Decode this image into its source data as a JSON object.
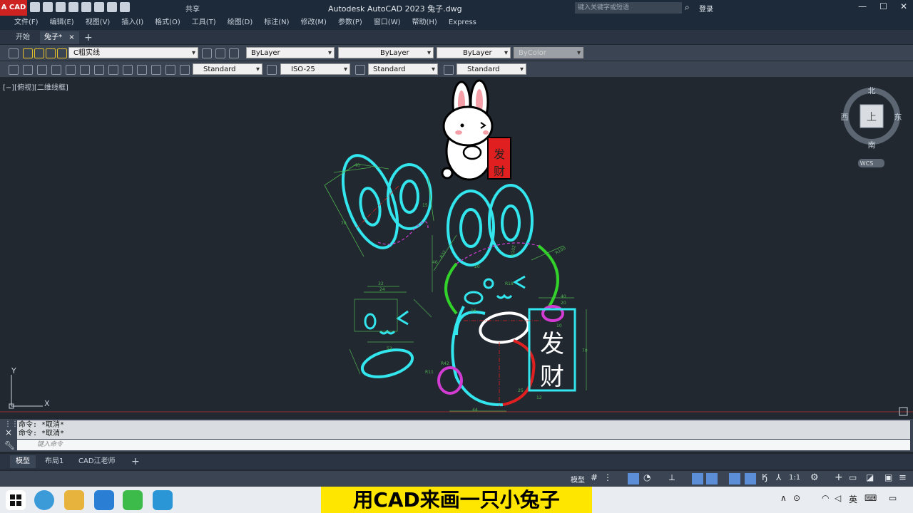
{
  "app": {
    "badge": "A CAD",
    "share": "共享",
    "window_title": "Autodesk AutoCAD 2023    兔子.dwg",
    "search_placeholder": "键入关键字或短语",
    "login": "登录"
  },
  "menu": [
    "文件(F)",
    "编辑(E)",
    "视图(V)",
    "插入(I)",
    "格式(O)",
    "工具(T)",
    "绘图(D)",
    "标注(N)",
    "修改(M)",
    "参数(P)",
    "窗口(W)",
    "帮助(H)",
    "Express"
  ],
  "doc_tabs": {
    "start": "开始",
    "current": "兔子*",
    "close": "×",
    "add": "+"
  },
  "toolbar1": {
    "layer": "C粗实线",
    "color": "ByLayer",
    "linetype": "ByLayer",
    "lineweight": "ByLayer",
    "plotstyle": "ByColor"
  },
  "toolbar2": {
    "text_style": "Standard",
    "dim_style": "ISO-25",
    "table_style": "Standard",
    "mleader_style": "Standard"
  },
  "viewport_label": "[−][俯视][二维线框]",
  "viewcube": {
    "north": "北",
    "south": "南",
    "east": "东",
    "west": "西",
    "face": "上",
    "wcs": "WCS"
  },
  "drawing": {
    "tag_char1": "发",
    "tag_char2": "财"
  },
  "dims": [
    "40",
    "70",
    "15",
    "24",
    "32",
    "52",
    "R32",
    "R18",
    "R100",
    "20",
    "R102",
    "16",
    "R11",
    "R42",
    "46",
    "44",
    "12",
    "70",
    "40",
    "20",
    "25",
    "10"
  ],
  "ucs": {
    "x": "X",
    "y": "Y"
  },
  "command": {
    "history": [
      "命令: *取消*",
      "命令: *取消*"
    ],
    "placeholder": "键入命令"
  },
  "layout_tabs": [
    "模型",
    "布局1",
    "CAD江老师"
  ],
  "layout_add": "+",
  "status": {
    "model": "模型",
    "scale": "1:1"
  },
  "caption": "用CAD来画一只小兔子",
  "tray": {
    "ime": "英"
  },
  "colors": {
    "cyan": "#33e6ee",
    "green": "#32d22a",
    "magenta": "#d23cd2",
    "red": "#e02020",
    "white": "#ffffff",
    "dim_green": "#4fb14f"
  }
}
